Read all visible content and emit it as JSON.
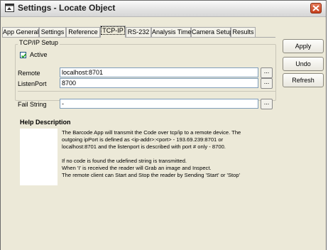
{
  "window": {
    "title": "Settings - Locate Object",
    "icon": "app-window-icon",
    "close_icon": "close-icon"
  },
  "tabs": [
    {
      "label": "App General",
      "active": false
    },
    {
      "label": "Settings",
      "active": false
    },
    {
      "label": "Reference",
      "active": false
    },
    {
      "label": "TCP-IP",
      "active": true
    },
    {
      "label": "RS-232",
      "active": false
    },
    {
      "label": "Analysis Time",
      "active": false
    },
    {
      "label": "Camera Setup",
      "active": false
    },
    {
      "label": "Results",
      "active": false
    }
  ],
  "tcp_setup": {
    "group_label": "TCP/IP Setup",
    "active_label": "Active",
    "active_checked": true,
    "remote_label": "Remote",
    "remote_value": "localhost:8701",
    "listen_label": "ListenPort",
    "listen_value": "8700",
    "fail_label": "Fail String",
    "fail_value": "-",
    "browse_label": "..."
  },
  "help": {
    "title": "Help Description",
    "lines": [
      "The Barcode App will transmit the Code over tcp/ip to a remote device. The",
      "outgoing ipPort is defined as <ip-addr>:<port> - 193.69.239:8701 or",
      "localhost:8701 and the listenport is described with port # only - 8700.",
      "If no code is found the udefined string is transmitted.",
      "When 'I' is received the reader will Grab an image and Inspect.",
      "The remote client can Start and Stop the reader by Sending 'Start' or 'Stop'"
    ]
  },
  "buttons": {
    "apply": "Apply",
    "undo": "Undo",
    "refresh": "Refresh"
  }
}
